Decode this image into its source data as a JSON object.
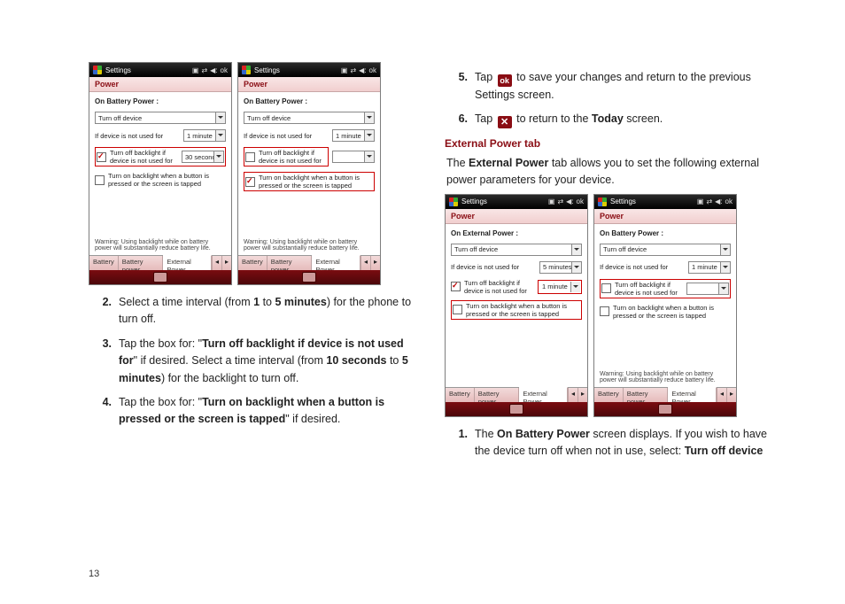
{
  "page_number": "13",
  "left_column": {
    "steps": [
      {
        "num": "2",
        "parts": [
          "Select a time interval (from ",
          "1",
          " to ",
          "5 minutes",
          ") for the phone to turn off."
        ]
      },
      {
        "num": "3",
        "parts": [
          "Tap the box for: \"",
          "Turn off backlight if device is not used for",
          "\" if desired. Select a time interval (from ",
          "10 seconds",
          " to ",
          "5 minutes",
          ") for the backlight to turn off."
        ]
      },
      {
        "num": "4",
        "parts": [
          "Tap the box for: \"",
          "Turn on backlight when a button is pressed or the screen is tapped",
          "\" if desired."
        ]
      }
    ]
  },
  "right_column": {
    "steps_a": [
      {
        "num": "5",
        "pre": "Tap ",
        "icon": "ok",
        "post": " to save your changes and return to the previous Settings screen."
      },
      {
        "num": "6",
        "pre": "Tap ",
        "icon": "x",
        "post_pre": " to return to the ",
        "post_bold": "Today",
        "post_tail": " screen."
      }
    ],
    "section_title": "External Power tab",
    "intro_pre": "The ",
    "intro_bold": "External Power",
    "intro_post": " tab allows you to set the following external power parameters for your device.",
    "steps_b": [
      {
        "num": "1",
        "pre": "The ",
        "bold1": "On Battery Power",
        "mid": " screen displays. If you wish to have the device turn off when not in use, select: ",
        "bold2": "Turn off device"
      }
    ]
  },
  "device_common": {
    "settings": "Settings",
    "power": "Power",
    "ok": "ok",
    "turn_off_device": "Turn off device",
    "if_not_used": "If device is not used for",
    "backlight_off": "Turn off backlight if device is not used for",
    "backlight_on": "Turn on backlight when a button is pressed or the screen is tapped",
    "warning": "Warning: Using backlight while on battery power will substantially reduce battery life.",
    "tabs": {
      "battery": "Battery",
      "battery_power": "Battery power",
      "external_power": "External Power"
    }
  },
  "devices_left": [
    {
      "heading": "On Battery Power :",
      "time1": "1 minute",
      "time2": "30 seconds",
      "chk1": true,
      "chk2": true,
      "chk3": false,
      "highlight": "time2_row"
    },
    {
      "heading": "On Battery Power :",
      "time1": "1 minute",
      "time2": "",
      "chk1": true,
      "chk2": false,
      "chk3": true,
      "highlight": "chk2_and_chk3"
    }
  ],
  "devices_right": [
    {
      "heading": "On External Power :",
      "time1": "5 minutes",
      "time2": "1 minute",
      "chk1": true,
      "chk2": true,
      "chk3": false,
      "highlight": "chk2_time_and_chk3"
    },
    {
      "heading": "On Battery Power :",
      "time1": "1 minute",
      "time2": "",
      "chk1": true,
      "chk2": false,
      "chk3": false,
      "highlight": "chk2_row"
    }
  ]
}
